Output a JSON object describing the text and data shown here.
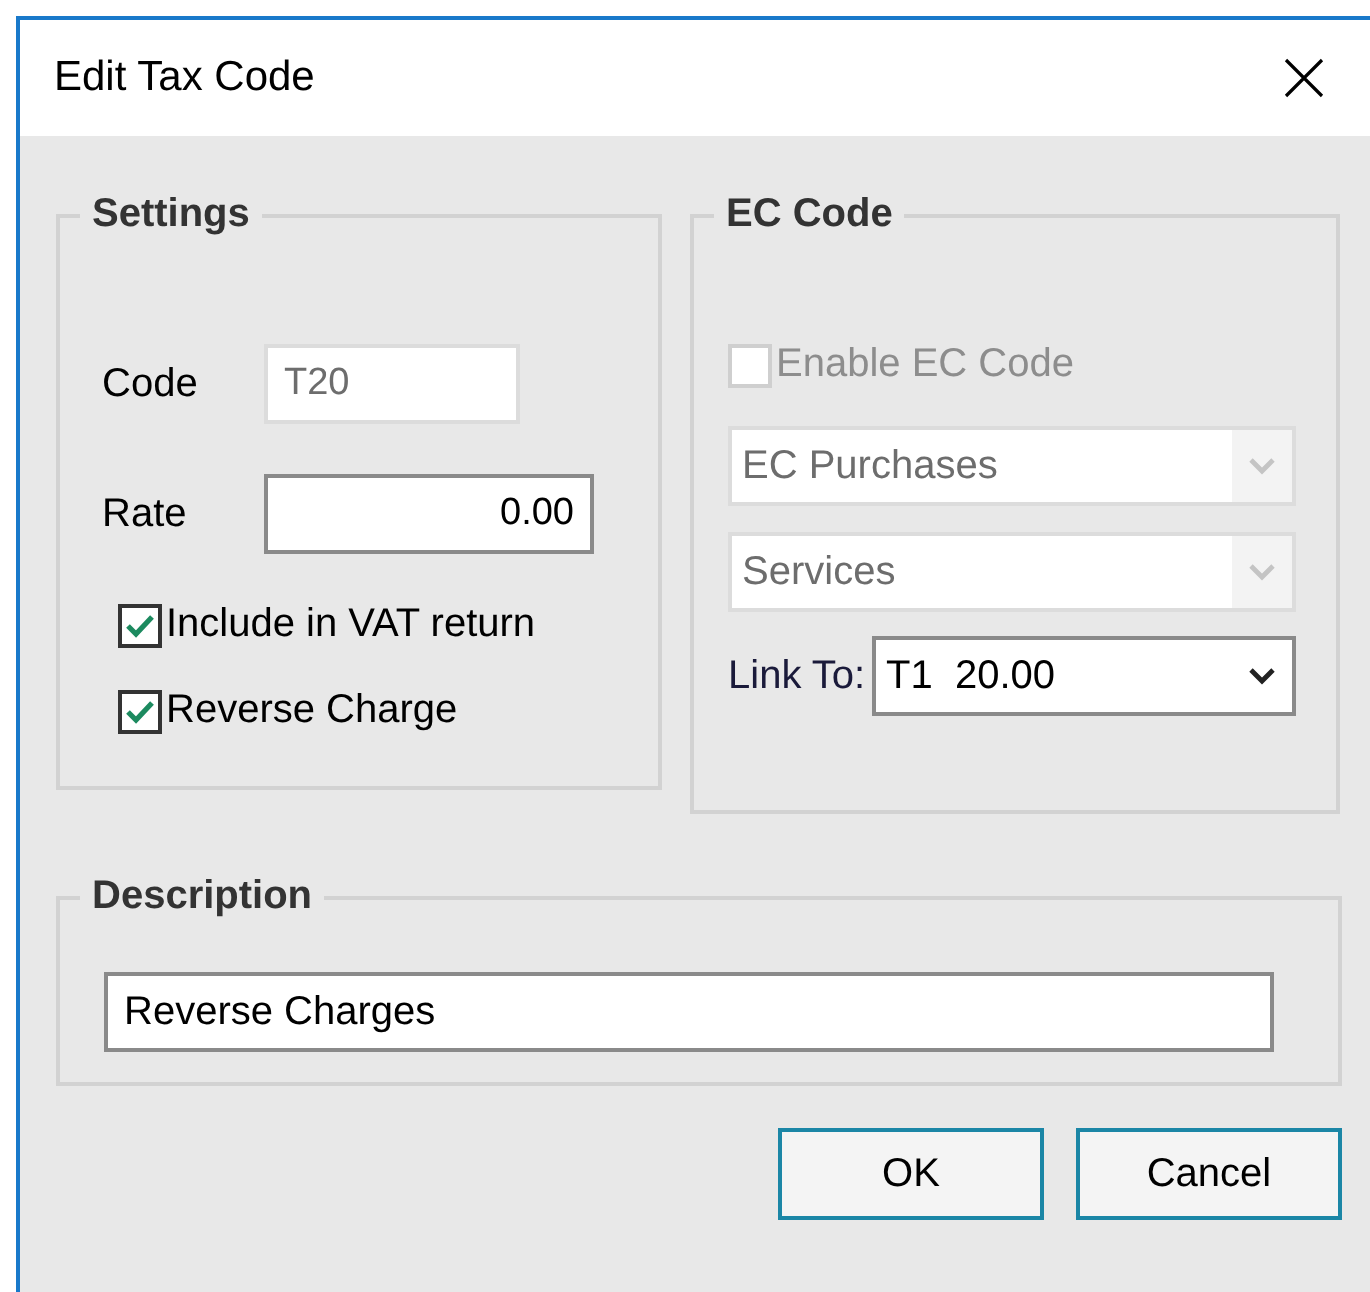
{
  "window": {
    "title": "Edit Tax Code"
  },
  "settings": {
    "title": "Settings",
    "fields": [
      {
        "label": "Code",
        "value": "T20",
        "disabled": true
      },
      {
        "label": "Rate",
        "value": "0.00",
        "disabled": false
      }
    ],
    "checkboxes": [
      {
        "label": "Include in VAT return",
        "checked": true,
        "disabled": false
      },
      {
        "label": "Reverse Charge",
        "checked": true,
        "disabled": false
      }
    ]
  },
  "ec_code": {
    "title": "EC Code",
    "enable": {
      "label": "Enable EC Code",
      "checked": false,
      "disabled": true
    },
    "dropdowns": [
      {
        "value": "EC Purchases",
        "disabled": true
      },
      {
        "value": "Services",
        "disabled": true
      }
    ],
    "link_to": {
      "label": "Link To:",
      "value": "T1  20.00",
      "disabled": false
    }
  },
  "description": {
    "title": "Description",
    "value": "Reverse Charges"
  },
  "buttons": [
    "OK",
    "Cancel"
  ]
}
